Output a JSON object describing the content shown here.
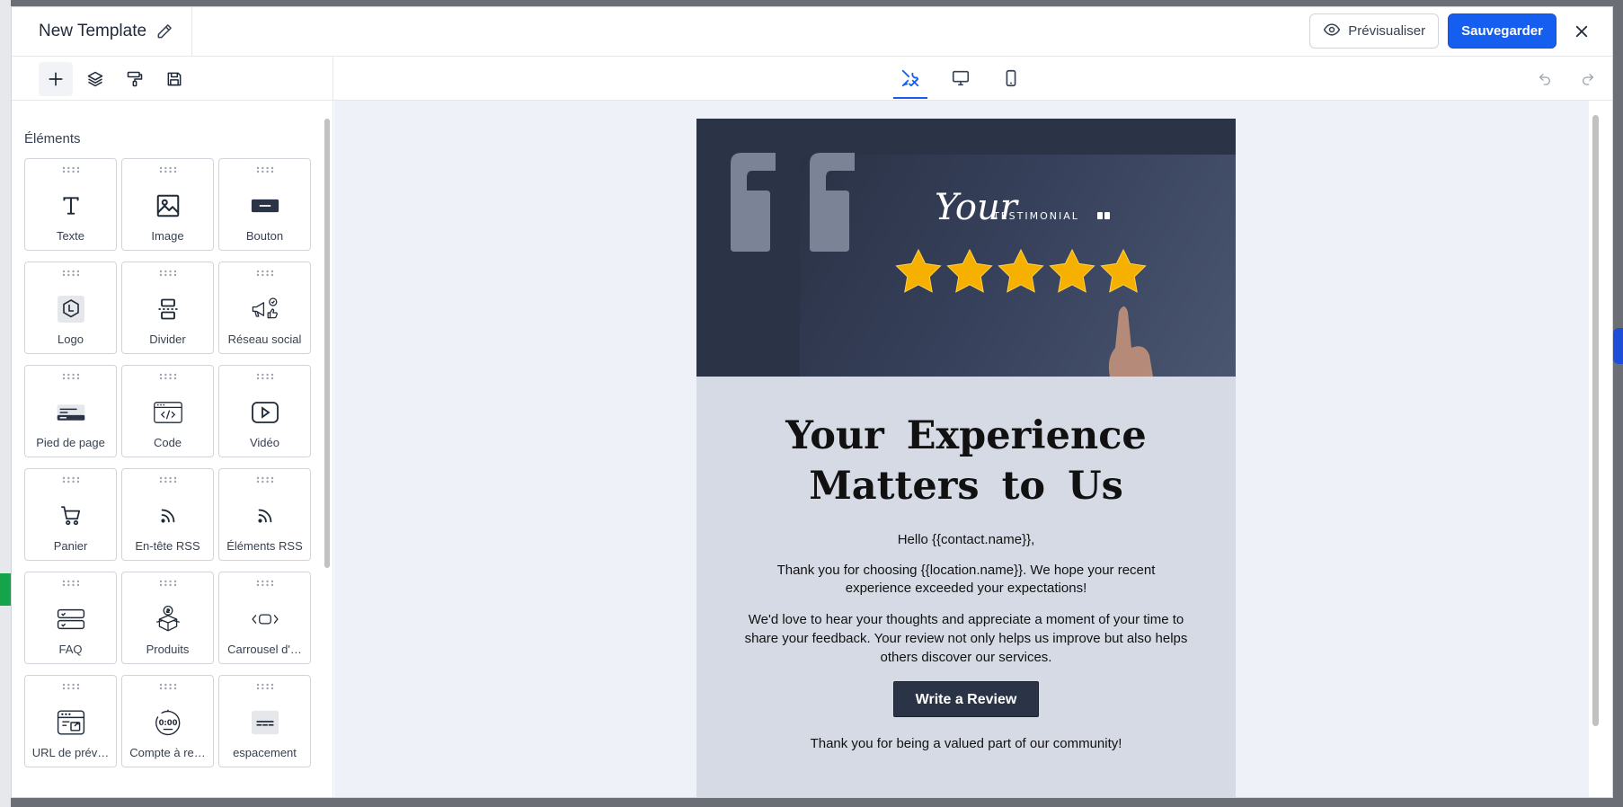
{
  "header": {
    "title": "New Template",
    "preview_label": "Prévisualiser",
    "save_label": "Sauvegarder"
  },
  "toolbar": {
    "left_icons": [
      "plus-icon",
      "layers-icon",
      "paint-roller-icon",
      "floppy-disk-icon"
    ],
    "device_icons": [
      "tools-icon",
      "desktop-icon",
      "mobile-icon"
    ],
    "history_icons": [
      "undo-icon",
      "redo-icon"
    ]
  },
  "sidebar": {
    "heading": "Éléments",
    "tiles": [
      {
        "label": "Texte",
        "icon": "text-icon"
      },
      {
        "label": "Image",
        "icon": "image-icon"
      },
      {
        "label": "Bouton",
        "icon": "button-icon"
      },
      {
        "label": "Logo",
        "icon": "logo-icon"
      },
      {
        "label": "Divider",
        "icon": "divider-icon"
      },
      {
        "label": "Réseau social",
        "icon": "social-icon"
      },
      {
        "label": "Pied de page",
        "icon": "footer-icon"
      },
      {
        "label": "Code",
        "icon": "code-icon"
      },
      {
        "label": "Vidéo",
        "icon": "video-icon"
      },
      {
        "label": "Panier",
        "icon": "cart-icon"
      },
      {
        "label": "En-tête RSS",
        "icon": "rss-icon"
      },
      {
        "label": "Éléments RSS",
        "icon": "rss-icon"
      },
      {
        "label": "FAQ",
        "icon": "faq-icon"
      },
      {
        "label": "Produits",
        "icon": "products-icon"
      },
      {
        "label": "Carrousel d'…",
        "icon": "carousel-icon"
      },
      {
        "label": "URL de prév…",
        "icon": "url-preview-icon"
      },
      {
        "label": "Compte à re…",
        "icon": "countdown-icon"
      },
      {
        "label": "espacement",
        "icon": "spacer-icon"
      }
    ]
  },
  "email": {
    "hero_script": "Your",
    "hero_caps": "TESTIMONIAL",
    "countdown_text": "0:00",
    "headline_line1": "Your Experience",
    "headline_line2": "Matters to Us",
    "greeting": "Hello {{contact.name}},",
    "paragraph1": "Thank you for choosing {{location.name}}. We hope your recent experience exceeded your expectations!",
    "paragraph2": "We'd love to hear your thoughts and appreciate a moment of your time to share your feedback. Your review not only helps us improve but also helps others discover our services.",
    "cta_label": "Write a Review",
    "closing": "Thank you for being a valued part of our community!"
  },
  "colors": {
    "primary": "#155eef",
    "hero_bg": "#2b3447",
    "body_bg": "#d5dae5",
    "canvas_bg": "#eef2f8",
    "star": "#f5b000"
  }
}
